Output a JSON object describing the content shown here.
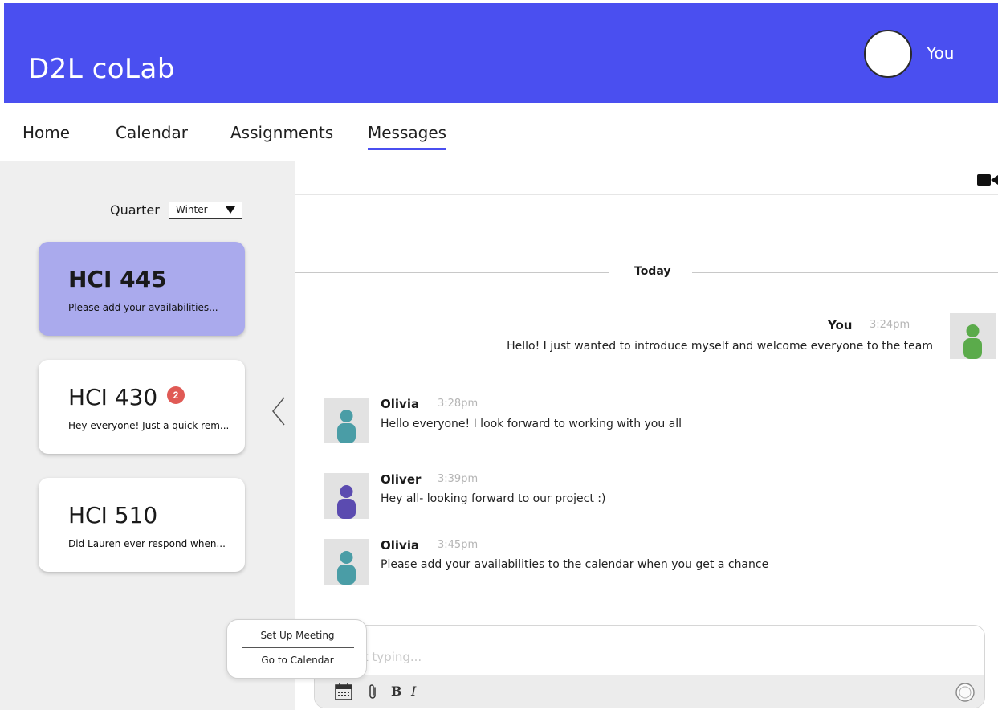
{
  "header": {
    "brand": "D2L coLab",
    "profile_label": "You"
  },
  "nav": {
    "items": [
      {
        "label": "Home"
      },
      {
        "label": "Calendar"
      },
      {
        "label": "Assignments"
      },
      {
        "label": "Messages"
      }
    ],
    "active": "Messages"
  },
  "sidebar": {
    "quarter_label": "Quarter",
    "quarter_value": "Winter",
    "courses": [
      {
        "title": "HCI 445",
        "preview": "Please add your availabilities...",
        "active": true
      },
      {
        "title": "HCI 430",
        "preview": "Hey everyone! Just a quick rem...",
        "badge": "2"
      },
      {
        "title": "HCI 510",
        "preview": "Did Lauren ever respond when..."
      }
    ]
  },
  "chat": {
    "day_label": "Today",
    "messages": [
      {
        "name": "You",
        "time": "3:24pm",
        "text": "Hello! I just wanted to introduce myself and welcome everyone to the team",
        "avatar_color": "#5bab4b"
      },
      {
        "name": "Olivia",
        "time": "3:28pm",
        "text": "Hello everyone! I look forward to working with you all",
        "avatar_color": "#4a9da6"
      },
      {
        "name": "Oliver",
        "time": "3:39pm",
        "text": "Hey all- looking forward to our project :)",
        "avatar_color": "#5b4bb0"
      },
      {
        "name": "Olivia",
        "time": "3:45pm",
        "text": "Please add your availabilities to the calendar when you get a chance",
        "avatar_color": "#4a9da6"
      }
    ],
    "composer": {
      "placeholder": "Start typing...",
      "bold_label": "B",
      "italic_label": "I"
    }
  },
  "popup": {
    "items": [
      "Set Up Meeting",
      "Go to Calendar"
    ]
  },
  "colors": {
    "brand": "#4a4ff0",
    "active_card": "#aaaaed",
    "badge": "#e05a55"
  },
  "icons": [
    "video-camera-icon",
    "chevron-left-icon",
    "calendar-icon",
    "paperclip-icon",
    "emoji-icon",
    "person-icon"
  ]
}
